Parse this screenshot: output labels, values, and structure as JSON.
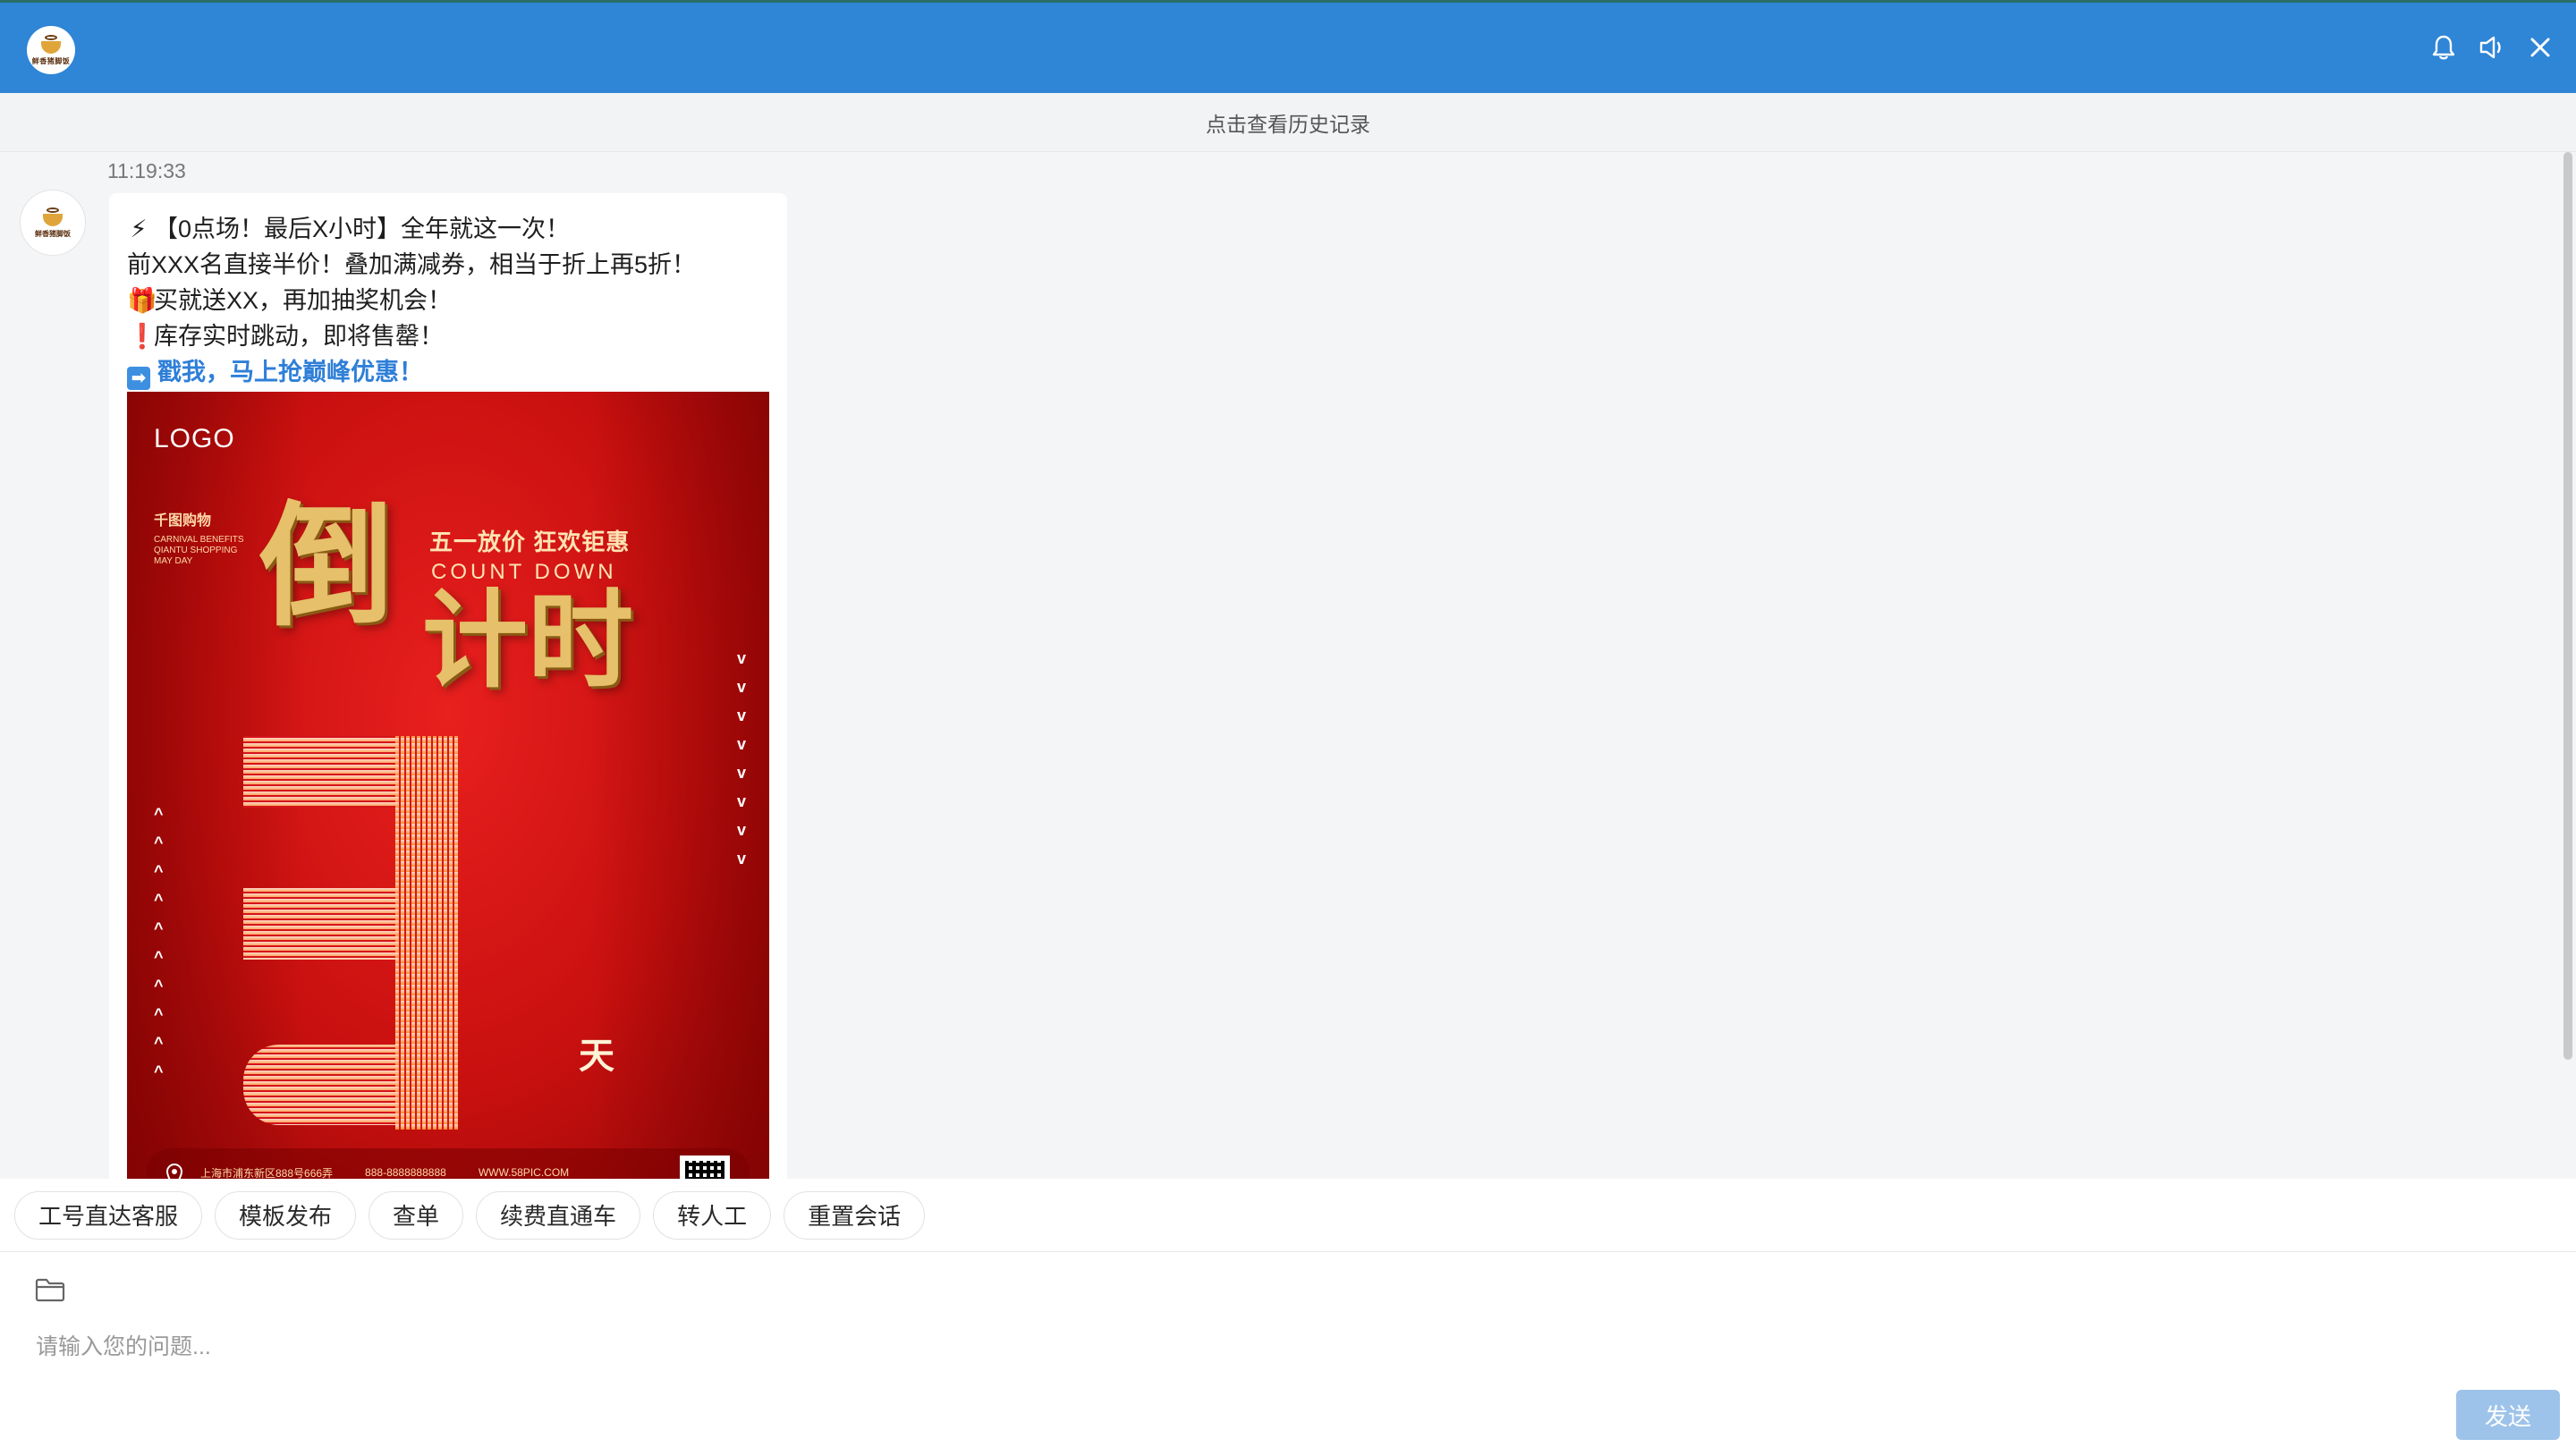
{
  "header": {
    "logo_text": "鲜香猪脚饭",
    "icons": [
      "bell-icon",
      "speaker-icon",
      "close-icon"
    ],
    "background_color": "#2f85d6"
  },
  "history": {
    "label": "点击查看历史记录"
  },
  "chat": {
    "timestamp": "11:19:33",
    "avatar_text": "鲜香猪脚饭",
    "message": {
      "line1_emoji": "⚡",
      "line1": "【0点场！最后X小时】全年就这一次！",
      "line2": "前XXX名直接半价！叠加满减券，相当于折上再5折！",
      "line3_emoji": "🎁",
      "line3": "买就送XX，再加抽奖机会！",
      "line4_emoji": "❗",
      "line4": "库存实时跳动，即将售罄！",
      "line5_emoji": "➡",
      "line5": "戳我，马上抢巅峰优惠！"
    },
    "poster": {
      "logo": "LOGO",
      "brand": "千图购物",
      "small": "CARNIVAL BENEFITS\nQIANTU SHOPPING\nMAY DAY",
      "line1": "五一放价 狂欢钜惠",
      "count_down": "COUNT DOWN",
      "big1": "倒",
      "big2": "计时",
      "number": "3",
      "day": "天",
      "footer_address": "上海市浦东新区888号666弄",
      "footer_phone": "888-8888888888",
      "footer_url": "WWW.58PIC.COM"
    }
  },
  "quick_actions": [
    "工号直达客服",
    "模板发布",
    "查单",
    "续费直通车",
    "转人工",
    "重置会话"
  ],
  "input": {
    "placeholder": "请输入您的问题...",
    "value": "",
    "send_label": "发送"
  }
}
